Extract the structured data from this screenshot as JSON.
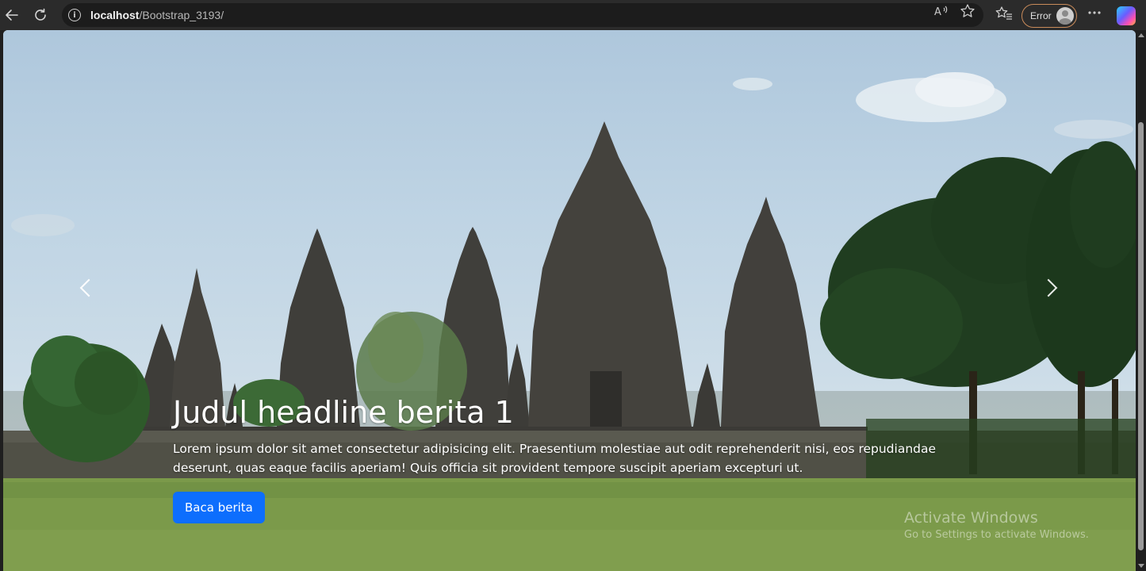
{
  "browser": {
    "url_host": "localhost",
    "url_path": "/Bootstrap_3193/",
    "profile_label": "Error",
    "icons": {
      "back": "back-arrow-icon",
      "reload": "reload-icon",
      "site_info": "info-icon",
      "read_aloud": "read-aloud-icon",
      "favorite": "star-icon",
      "favorites": "favorites-icon",
      "more": "more-icon",
      "copilot": "copilot-icon"
    }
  },
  "carousel": {
    "headline": "Judul headline berita 1",
    "body": "Lorem ipsum dolor sit amet consectetur adipisicing elit. Praesentium molestiae aut odit reprehenderit nisi, eos repudiandae deserunt, quas eaque facilis aperiam! Quis officia sit provident tempore suscipit aperiam excepturi ut.",
    "button_label": "Baca berita",
    "prev_icon": "chevron-left-icon",
    "next_icon": "chevron-right-icon"
  },
  "watermark": {
    "title": "Activate Windows",
    "subtitle": "Go to Settings to activate Windows."
  },
  "colors": {
    "primary_button": "#0d6efd",
    "chrome_bg": "#2b2b2b",
    "profile_border": "#c98b5a"
  }
}
